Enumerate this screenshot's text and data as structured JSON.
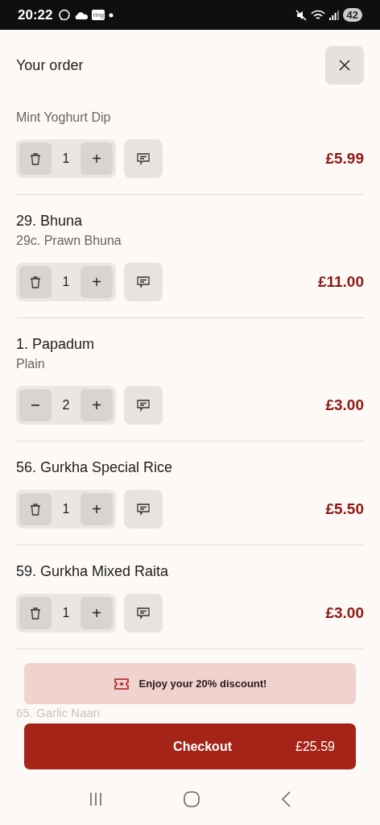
{
  "status_bar": {
    "time": "20:22",
    "notification_badge": "ring",
    "battery": "42"
  },
  "header": {
    "title": "Your order"
  },
  "items": [
    {
      "option": "Mint Yoghurt Dip",
      "quantity": "1",
      "kind": "removable",
      "increment": "+",
      "price": "£5.99"
    },
    {
      "name": "29. Bhuna",
      "option": "29c. Prawn Bhuna",
      "quantity": "1",
      "kind": "removable",
      "increment": "+",
      "price": "£11.00"
    },
    {
      "name": "1. Papadum",
      "option": "Plain",
      "quantity": "2",
      "kind": "decreasable",
      "increment": "+",
      "price": "£3.00"
    },
    {
      "name": "56. Gurkha Special Rice",
      "quantity": "1",
      "kind": "removable",
      "increment": "+",
      "price": "£5.50"
    },
    {
      "name": "59. Gurkha Mixed Raita",
      "quantity": "1",
      "kind": "removable",
      "increment": "+",
      "price": "£3.00"
    }
  ],
  "next_item_peek": "65. Garlic Naan",
  "discount_banner": {
    "text": "Enjoy your 20% discount!"
  },
  "checkout": {
    "label": "Checkout",
    "total": "£25.59"
  }
}
